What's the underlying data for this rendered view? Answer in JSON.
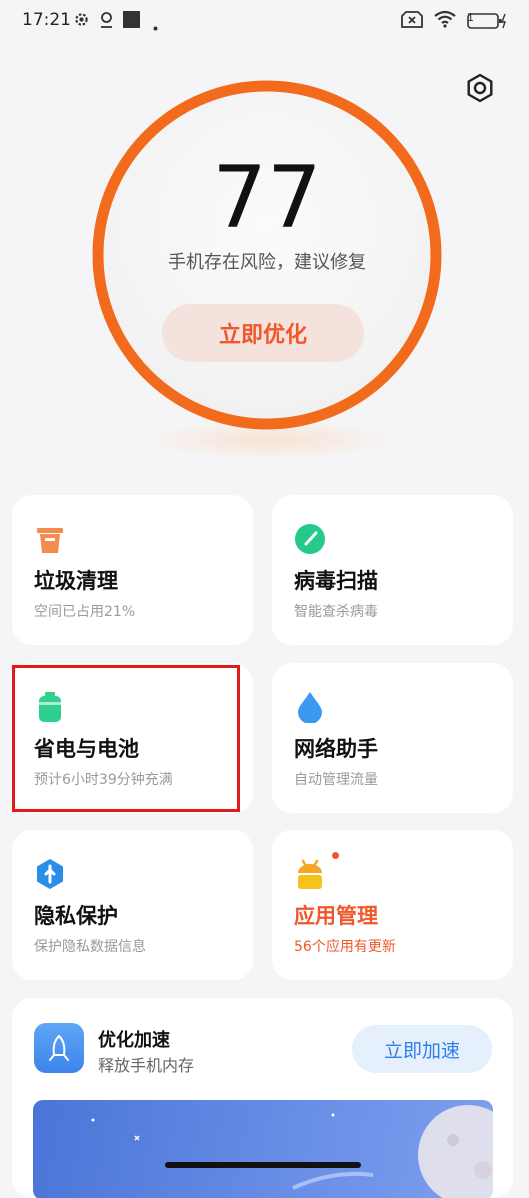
{
  "status_bar": {
    "time": "17:21",
    "battery": "1"
  },
  "score": {
    "value": "77",
    "message": "手机存在风险，建议修复",
    "button": "立即优化"
  },
  "cards": [
    {
      "title": "垃圾清理",
      "subtitle": "空间已占用21%"
    },
    {
      "title": "病毒扫描",
      "subtitle": "智能查杀病毒"
    },
    {
      "title": "省电与电池",
      "subtitle": "预计6小时39分钟充满"
    },
    {
      "title": "网络助手",
      "subtitle": "自动管理流量"
    },
    {
      "title": "隐私保护",
      "subtitle": "保护隐私数据信息"
    },
    {
      "title": "应用管理",
      "subtitle": "56个应用有更新"
    }
  ],
  "boost": {
    "title": "优化加速",
    "subtitle": "释放手机内存",
    "button": "立即加速"
  },
  "colors": {
    "accent": "#f0572b",
    "ring": "#f26b1d",
    "blue": "#2f7fe8"
  }
}
